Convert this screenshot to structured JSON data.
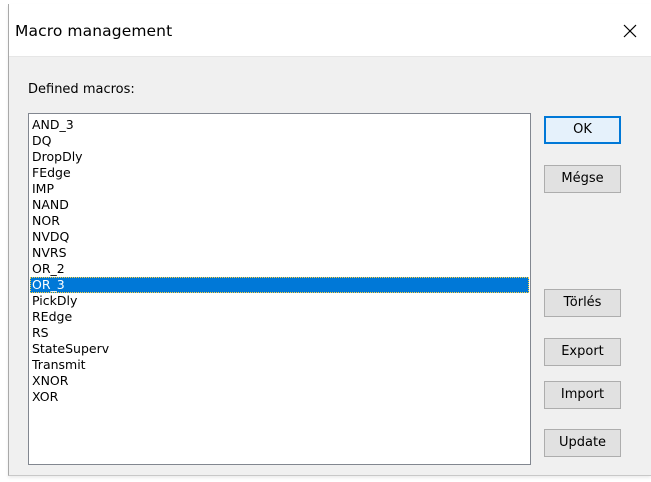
{
  "window": {
    "title": "Macro management",
    "close_icon": "close-icon"
  },
  "macros_label": "Defined macros:",
  "macros": [
    "AND_3",
    "DQ",
    "DropDly",
    "FEdge",
    "IMP",
    "NAND",
    "NOR",
    "NVDQ",
    "NVRS",
    "OR_2",
    "OR_3",
    "PickDly",
    "REdge",
    "RS",
    "StateSuperv",
    "Transmit",
    "XNOR",
    "XOR"
  ],
  "selected_macro": "OR_3",
  "buttons": {
    "ok": "OK",
    "cancel": "Mégse",
    "delete": "Törlés",
    "export": "Export",
    "import": "Import",
    "update": "Update"
  },
  "colors": {
    "selection": "#0078d7",
    "default_button_border": "#0078d7"
  }
}
